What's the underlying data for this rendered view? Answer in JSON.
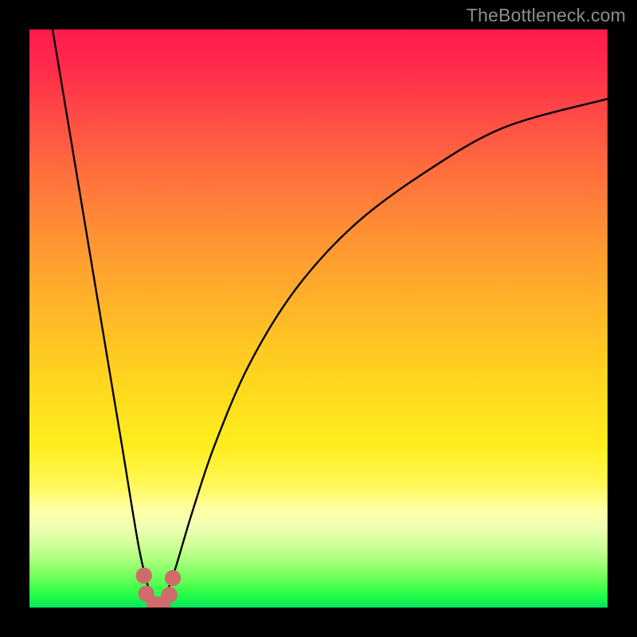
{
  "watermark": "TheBottleneck.com",
  "colors": {
    "frame": "#000000",
    "curve": "#000000",
    "blob": "#cf6b6b",
    "gradient_top": "#ff1a4d",
    "gradient_bottom": "#00e85a"
  },
  "chart_data": {
    "type": "line",
    "title": "",
    "xlabel": "",
    "ylabel": "",
    "xlim": [
      0,
      100
    ],
    "ylim": [
      0,
      100
    ],
    "note": "Cusp-shaped bottleneck curve. Minimum near x≈22, y≈0. Left branch rises to top-left corner. Right branch rises asymptotically to ~88% height at right edge. Values approximate, read from shape.",
    "x": [
      4,
      8,
      12,
      16,
      19,
      21,
      22,
      23,
      25,
      28,
      32,
      38,
      46,
      56,
      68,
      82,
      100
    ],
    "y": [
      100,
      76,
      52,
      28,
      10,
      2,
      0,
      1,
      6,
      16,
      28,
      42,
      55,
      66,
      75,
      83,
      88
    ],
    "blobs": [
      {
        "cx": 19.8,
        "cy": 5.5,
        "r": 1.4
      },
      {
        "cx": 20.2,
        "cy": 2.4,
        "r": 1.4
      },
      {
        "cx": 21.6,
        "cy": 0.6,
        "r": 1.4
      },
      {
        "cx": 23.0,
        "cy": 0.6,
        "r": 1.4
      },
      {
        "cx": 24.2,
        "cy": 2.2,
        "r": 1.4
      },
      {
        "cx": 24.8,
        "cy": 5.1,
        "r": 1.4
      }
    ]
  }
}
